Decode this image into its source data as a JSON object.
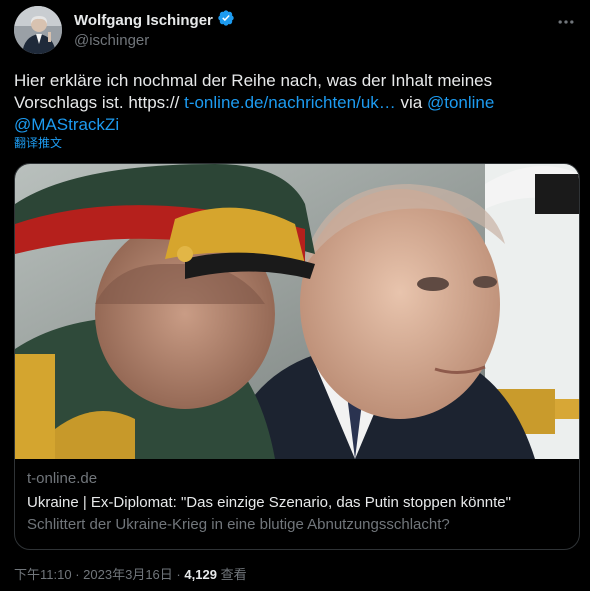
{
  "author": {
    "display_name": "Wolfgang Ischinger",
    "handle": "@ischinger",
    "verified_icon": "verified-badge-icon"
  },
  "tweet": {
    "text_plain": "Hier erkläre ich nochmal der Reihe nach, was der Inhalt meines Vorschlags ist. https://",
    "link_url": "t-online.de/nachrichten/uk…",
    "via_text": "via",
    "mention_1": "@tonline",
    "mention_2": "@MAStrackZi",
    "translate_label": "翻译推文"
  },
  "card": {
    "domain": "t-online.de",
    "title": "Ukraine | Ex-Diplomat: \"Das einzige Szenario, das Putin stoppen könnte\"",
    "description": "Schlittert der Ukraine-Krieg in eine blutige Abnutzungsschlacht?"
  },
  "footer": {
    "time": "下午11:10",
    "separator": "·",
    "date": "2023年3月16日",
    "views_count": "4,129",
    "views_label": "查看"
  },
  "colors": {
    "background": "#000000",
    "text_primary": "#e7e9ea",
    "text_secondary": "#71767b",
    "link": "#1d9bf0",
    "border": "#2f3336",
    "verified": "#1d9bf0"
  },
  "icons": {
    "more": "more-horizontal-icon"
  }
}
